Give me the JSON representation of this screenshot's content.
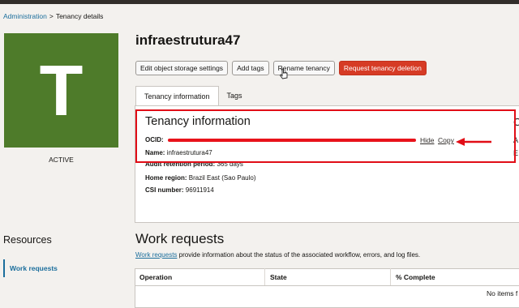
{
  "breadcrumb": {
    "parent": "Administration",
    "separator": ">",
    "current": "Tenancy details"
  },
  "tenancy": {
    "initial": "T",
    "name": "infraestrutura47",
    "status": "ACTIVE",
    "tile_color": "#4e7b2a"
  },
  "resources": {
    "title": "Resources",
    "items": [
      {
        "label": "Work requests"
      }
    ]
  },
  "actions": {
    "edit_storage": "Edit object storage settings",
    "add_tags": "Add tags",
    "rename": "Rename tenancy",
    "request_deletion": "Request tenancy deletion"
  },
  "tabs": [
    {
      "label": "Tenancy information",
      "active": true
    },
    {
      "label": "Tags",
      "active": false
    }
  ],
  "info": {
    "title": "Tenancy information",
    "ocid_label": "OCID:",
    "hide_link": "Hide",
    "copy_link": "Copy",
    "name_label": "Name:",
    "name_value": "infraestrutura47",
    "audit_label": "Audit retention period:",
    "audit_value": "365 days",
    "region_label": "Home region:",
    "region_value": "Brazil East (Sao Paulo)",
    "csi_label": "CSI number:",
    "csi_value": "96911914"
  },
  "edge_text": {
    "first": "C",
    "second": "A",
    "third": "E"
  },
  "work_requests": {
    "title": "Work requests",
    "link_text": "Work requests",
    "description": " provide information about the status of the associated workflow, errors, and log files.",
    "columns": [
      "Operation",
      "State",
      "% Complete"
    ],
    "empty_text": "No items f"
  },
  "colors": {
    "link": "#1b6e9c",
    "danger": "#d63b25",
    "highlight": "#e10d16",
    "tile": "#4e7b2a"
  }
}
